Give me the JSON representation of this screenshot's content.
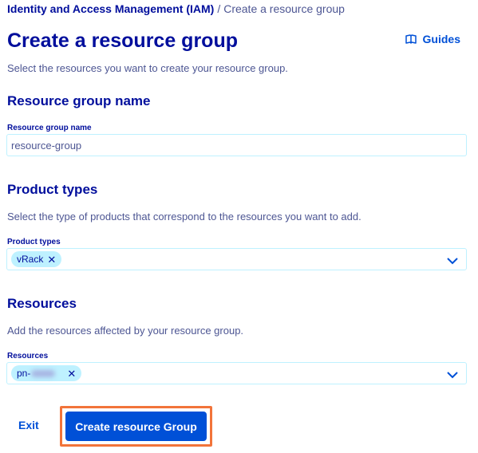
{
  "breadcrumb": {
    "parent": "Identity and Access Management (IAM)",
    "separator": "/",
    "current": "Create a resource group"
  },
  "header": {
    "title": "Create a resource group",
    "guides_label": "Guides",
    "guides_icon": "book-icon",
    "intro": "Select the resources you want to create your resource group."
  },
  "name_section": {
    "title": "Resource group name",
    "field_label": "Resource group name",
    "value": "resource-group"
  },
  "product_section": {
    "title": "Product types",
    "description": "Select the type of products that correspond to the resources you want to add.",
    "field_label": "Product types",
    "chips": [
      "vRack"
    ]
  },
  "resources_section": {
    "title": "Resources",
    "description": "Add the resources affected by your resource group.",
    "field_label": "Resources",
    "chips": [
      "pn-"
    ]
  },
  "actions": {
    "exit_label": "Exit",
    "create_label": "Create resource Group"
  },
  "colors": {
    "heading": "#000e9c",
    "text": "#4d5693",
    "primary": "#0050d7",
    "chip_bg": "#bef1ff",
    "highlight": "#f2743a"
  }
}
